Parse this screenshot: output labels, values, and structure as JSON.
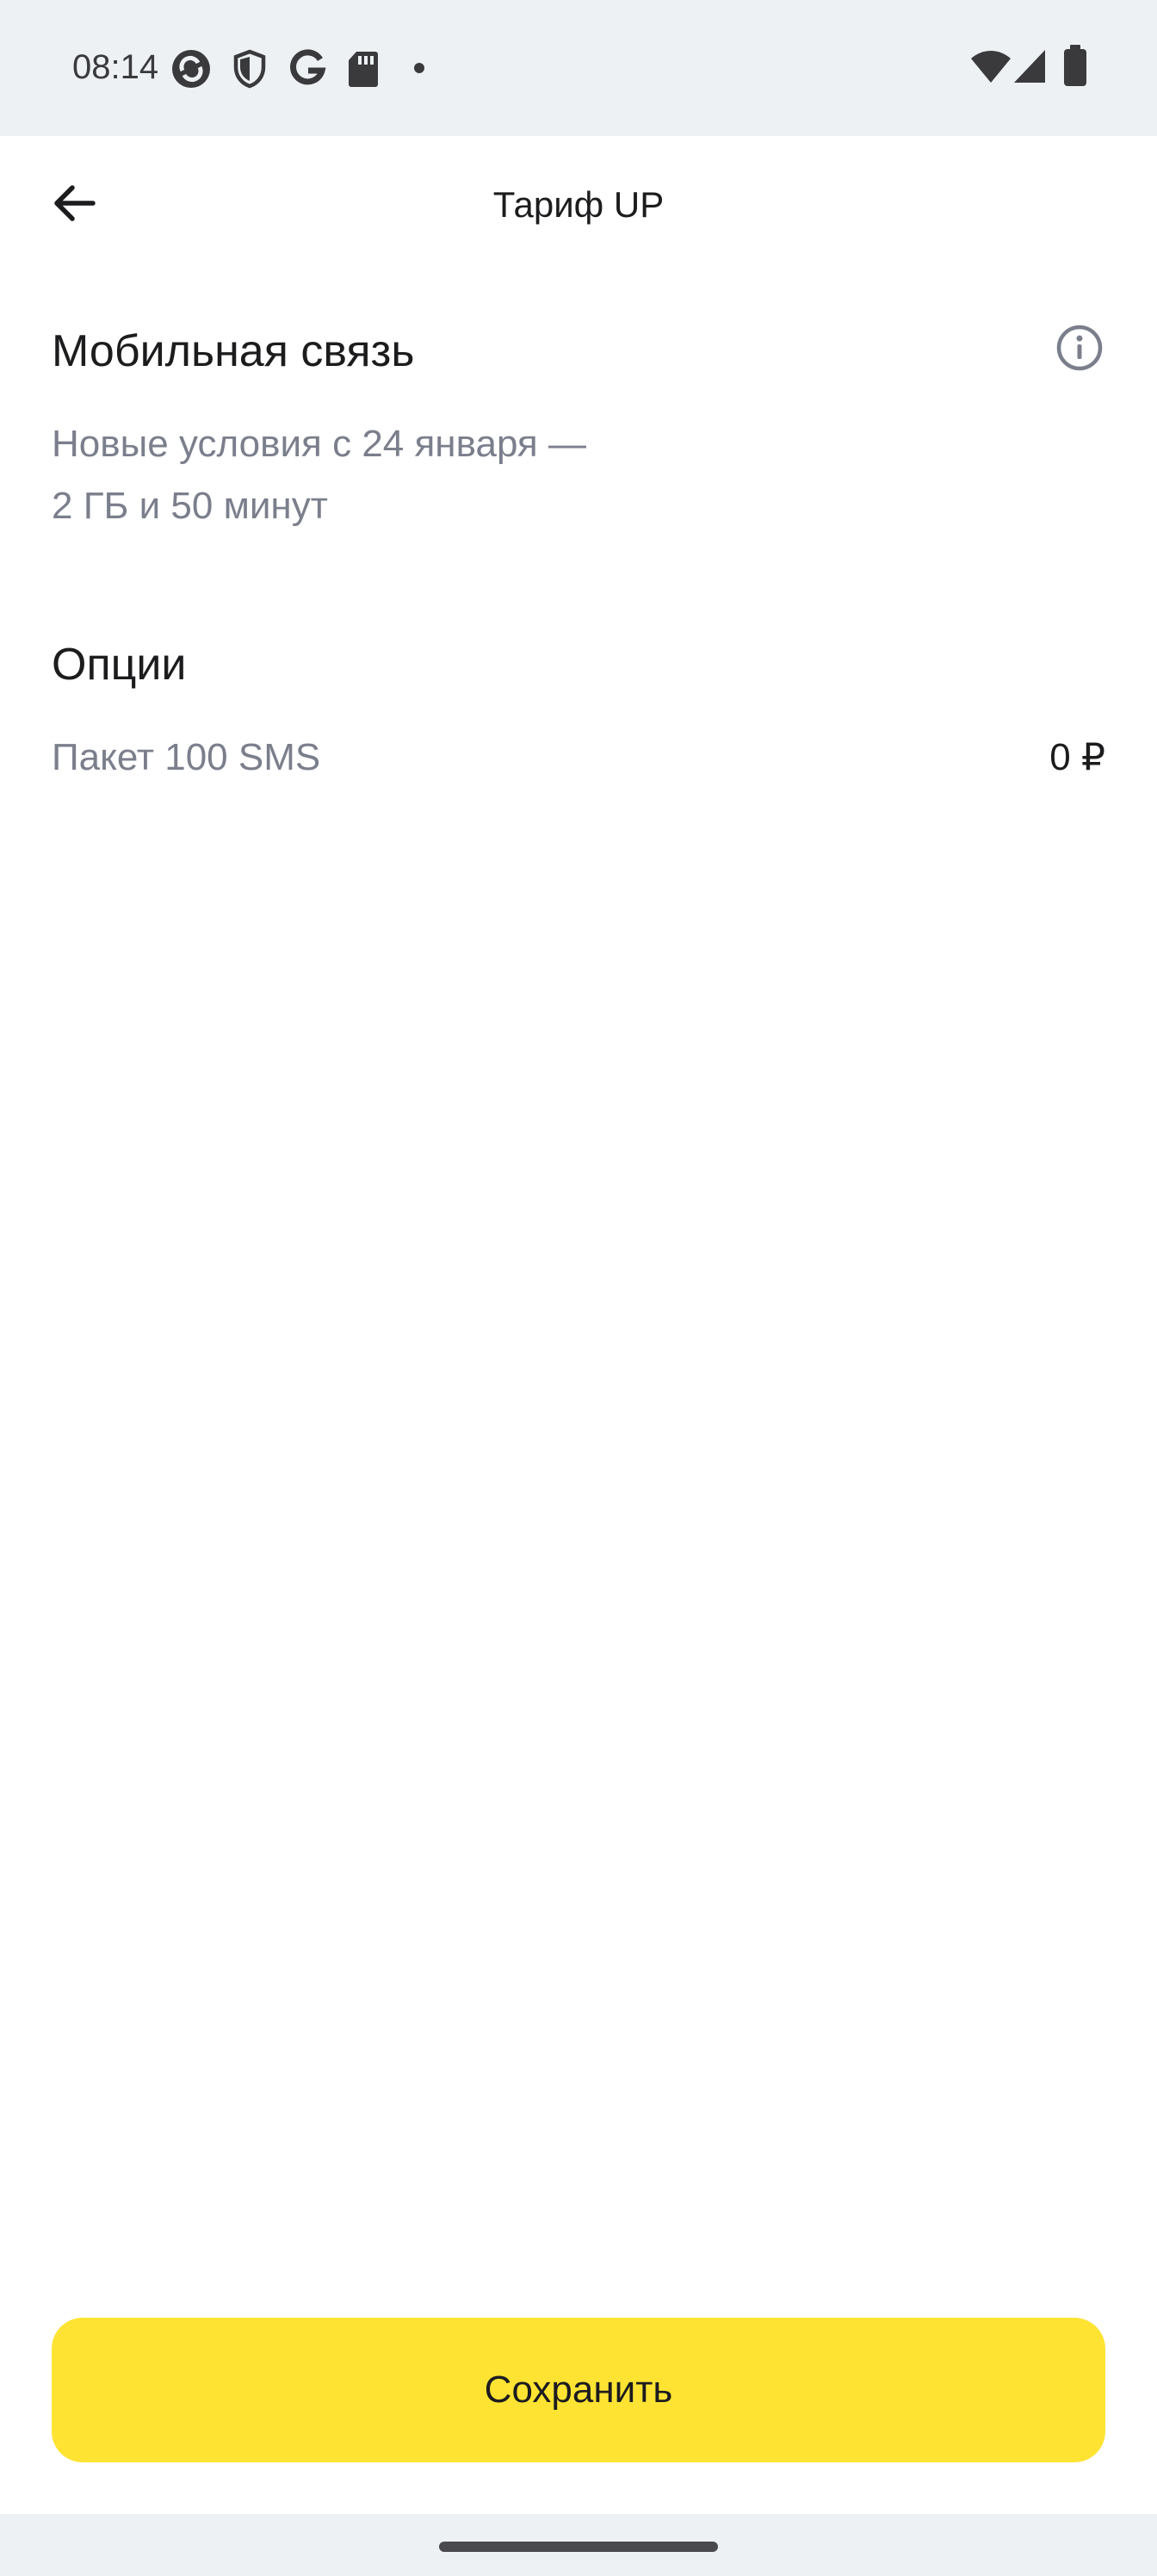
{
  "status_bar": {
    "time": "08:14",
    "left_icons": [
      "sync-icon",
      "shield-icon",
      "google-icon",
      "sd-card-icon",
      "dot-icon"
    ],
    "right_icons": [
      "wifi-icon",
      "signal-icon",
      "battery-icon"
    ]
  },
  "app_bar": {
    "title": "Тариф UP",
    "back_icon": "arrow-left-icon"
  },
  "mobile_section": {
    "title": "Мобильная связь",
    "info_icon": "info-icon",
    "description_line1": "Новые условия с 24 января —",
    "description_line2": "2 ГБ и 50 минут"
  },
  "options_section": {
    "title": "Опции",
    "items": [
      {
        "name": "Пакет 100 SMS",
        "price": "0 ₽"
      }
    ]
  },
  "actions": {
    "save_label": "Сохранить"
  },
  "colors": {
    "accent": "#ffe333",
    "status_bar_bg": "#eef1f4",
    "secondary_text": "#7b7f8c",
    "primary_text": "#1c1c1e"
  }
}
